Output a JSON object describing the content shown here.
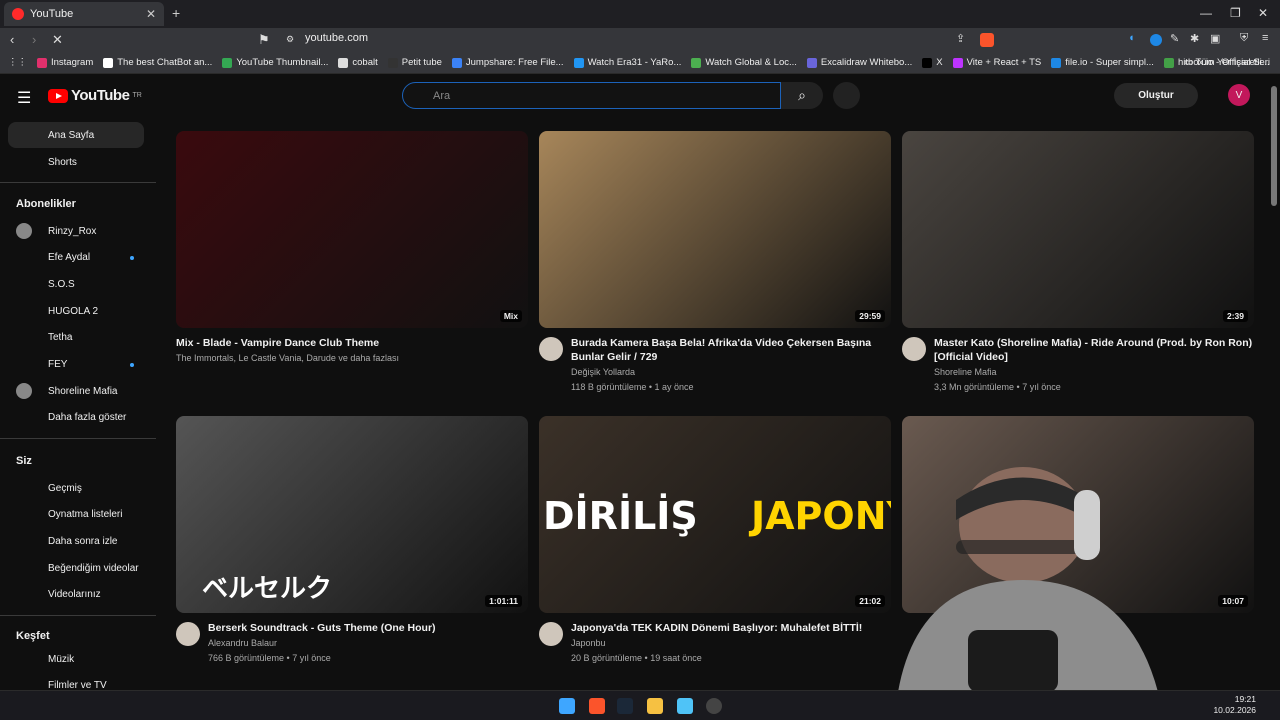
{
  "browser": {
    "tab_title": "YouTube",
    "url": "youtube.com",
    "bookmarks": [
      {
        "label": "Instagram",
        "color": "#e1306c"
      },
      {
        "label": "The best ChatBot an...",
        "color": "#ffffff"
      },
      {
        "label": "YouTube Thumbnail...",
        "color": "#34a853"
      },
      {
        "label": "cobalt",
        "color": "#dddddd"
      },
      {
        "label": "Petit tube",
        "color": "#333333"
      },
      {
        "label": "Jumpshare: Free File...",
        "color": "#3b82f6"
      },
      {
        "label": "Watch Era31 - YaRo...",
        "color": "#2196f3"
      },
      {
        "label": "Watch Global & Loc...",
        "color": "#4caf50"
      },
      {
        "label": "Excalidraw Whitebo...",
        "color": "#6965db"
      },
      {
        "label": "X",
        "color": "#000000"
      },
      {
        "label": "Vite + React + TS",
        "color": "#bd34fe"
      },
      {
        "label": "file.io - Super simpl...",
        "color": "#1e88e5"
      },
      {
        "label": "hitbox.io - Official Si...",
        "color": "#43a047"
      }
    ],
    "all_bookmarks": "Tüm Yer İşaretleri"
  },
  "header": {
    "logo_text": "YouTube",
    "logo_sup": "TR",
    "search_placeholder": "Ara",
    "create_label": "Oluştur",
    "avatar_letter": "V"
  },
  "sidebar": {
    "top": [
      {
        "label": "Ana Sayfa",
        "active": true
      },
      {
        "label": "Shorts"
      }
    ],
    "subs_heading": "Abonelikler",
    "subs": [
      {
        "label": "Rinzy_Rox",
        "avatar": true
      },
      {
        "label": "Efe Aydal",
        "dot": true
      },
      {
        "label": "S.O.S"
      },
      {
        "label": "HUGOLA 2"
      },
      {
        "label": "Tetha"
      },
      {
        "label": "FEY",
        "dot": true
      },
      {
        "label": "Shoreline Mafia",
        "avatar": true
      },
      {
        "label": "Daha fazla göster"
      }
    ],
    "you_heading": "Siz",
    "you": [
      {
        "label": "Geçmiş"
      },
      {
        "label": "Oynatma listeleri"
      },
      {
        "label": "Daha sonra izle"
      },
      {
        "label": "Beğendiğim videolar"
      },
      {
        "label": "Videolarınız"
      }
    ],
    "explore_heading": "Keşfet",
    "explore": [
      {
        "label": "Müzik"
      },
      {
        "label": "Filmler ve TV"
      }
    ]
  },
  "videos": [
    {
      "title": "Mix - Blade - Vampire Dance Club Theme",
      "channel": "The Immortals, Le Castle Vania, Darude ve daha fazlası",
      "stats": "",
      "badge": "Mix",
      "thumb_color": "#3a0a0e",
      "thumb_text": ""
    },
    {
      "title": "Burada Kamera Başa Bela! Afrika'da Video Çekersen Başına Bunlar Gelir / 729",
      "channel": "Değişik Yollarda",
      "stats": "118 B görüntüleme • 1 ay önce",
      "badge": "29:59",
      "thumb_color": "#a7865a",
      "thumb_text": ""
    },
    {
      "title": "Master Kato (Shoreline Mafia) - Ride Around (Prod. by Ron Ron) [Official Video]",
      "channel": "Shoreline Mafia",
      "stats": "3,3 Mn görüntüleme • 7 yıl önce",
      "badge": "2:39",
      "thumb_color": "#4a4540",
      "thumb_text": ""
    },
    {
      "title": "Berserk Soundtrack - Guts Theme (One Hour)",
      "channel": "Alexandru Balaur",
      "stats": "766 B görüntüleme • 7 yıl önce",
      "badge": "1:01:11",
      "thumb_color": "#555555",
      "thumb_text": "ベルセルク"
    },
    {
      "title": "Japonya'da TEK KADIN Dönemi Başlıyor: Muhalefet BİTTİ!",
      "channel": "Japonbu",
      "stats": "20 B görüntüleme • 19 saat önce",
      "badge": "21:02",
      "thumb_color": "#3b3128",
      "thumb_text": "DİRİLİŞ",
      "thumb_text2": "JAPONYA"
    },
    {
      "title": "",
      "channel": "",
      "stats": "",
      "badge": "10:07",
      "thumb_color": "#6a5a50",
      "thumb_text": ""
    }
  ],
  "taskbar": {
    "time": "19:21",
    "date": "10.02.2026"
  }
}
